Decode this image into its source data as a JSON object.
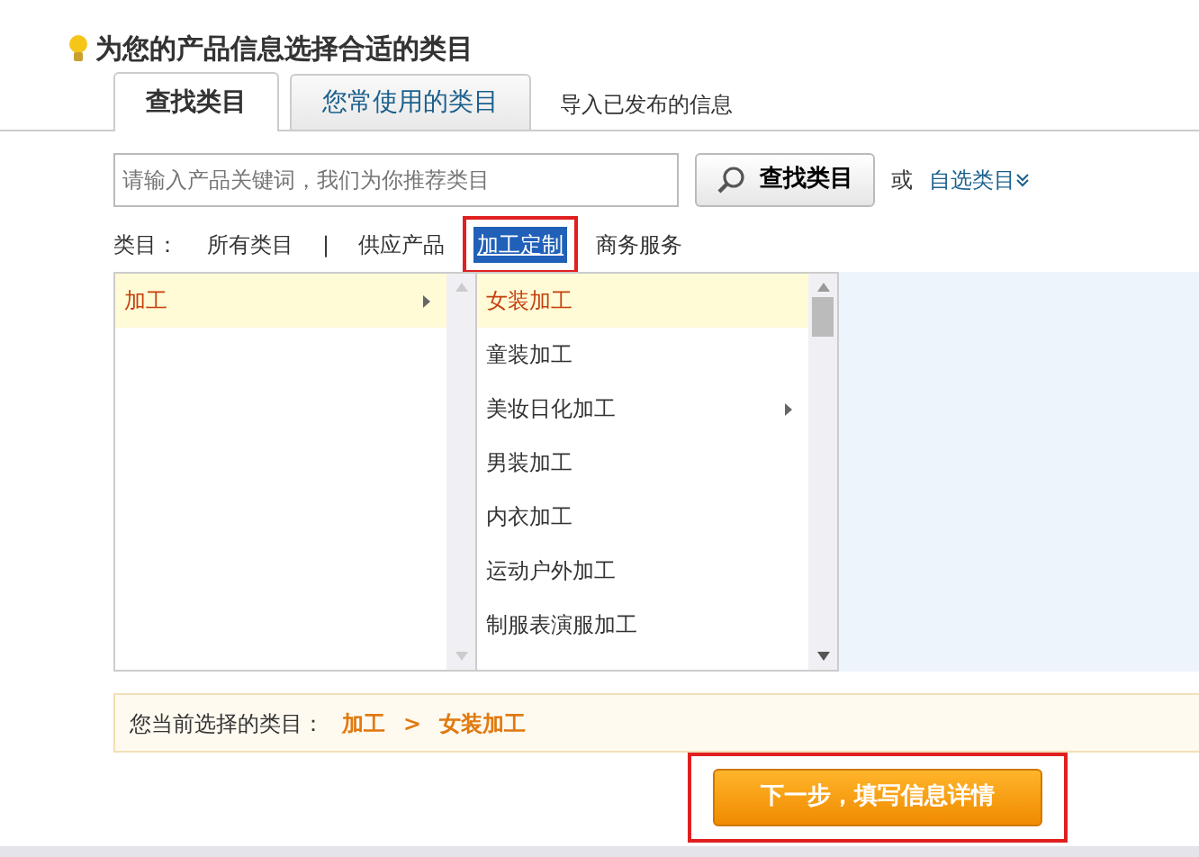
{
  "heading": "为您的产品信息选择合适的类目",
  "tabs": [
    {
      "label": "查找类目",
      "selected": true,
      "kind": "tab"
    },
    {
      "label": "您常使用的类目",
      "selected": false,
      "kind": "tab"
    },
    {
      "label": "导入已发布的信息",
      "selected": false,
      "kind": "link"
    }
  ],
  "search": {
    "placeholder": "请输入产品关键词，我们为你推荐类目",
    "button": "查找类目",
    "or_text": "或",
    "custom_link": "自选类目"
  },
  "category_filter": {
    "label": "类目：",
    "separator": "|",
    "items": [
      {
        "label": "所有类目",
        "selected": false,
        "highlighted": false
      },
      {
        "label": "供应产品",
        "selected": false,
        "highlighted": false
      },
      {
        "label": "加工定制",
        "selected": true,
        "highlighted": true
      },
      {
        "label": "商务服务",
        "selected": false,
        "highlighted": false
      }
    ]
  },
  "columns": [
    {
      "items": [
        {
          "label": "加工",
          "selected": true,
          "has_children": true
        }
      ]
    },
    {
      "items": [
        {
          "label": "女装加工",
          "selected": true,
          "has_children": false
        },
        {
          "label": "童装加工",
          "selected": false,
          "has_children": false
        },
        {
          "label": "美妆日化加工",
          "selected": false,
          "has_children": true
        },
        {
          "label": "男装加工",
          "selected": false,
          "has_children": false
        },
        {
          "label": "内衣加工",
          "selected": false,
          "has_children": false
        },
        {
          "label": "运动户外加工",
          "selected": false,
          "has_children": false
        },
        {
          "label": "制服表演服加工",
          "selected": false,
          "has_children": false
        }
      ]
    }
  ],
  "current_selection": {
    "label": "您当前选择的类目：",
    "path": [
      "加工",
      "女装加工"
    ],
    "separator": ">"
  },
  "next_button": {
    "label": "下一步，填写信息详情",
    "highlighted": true
  }
}
